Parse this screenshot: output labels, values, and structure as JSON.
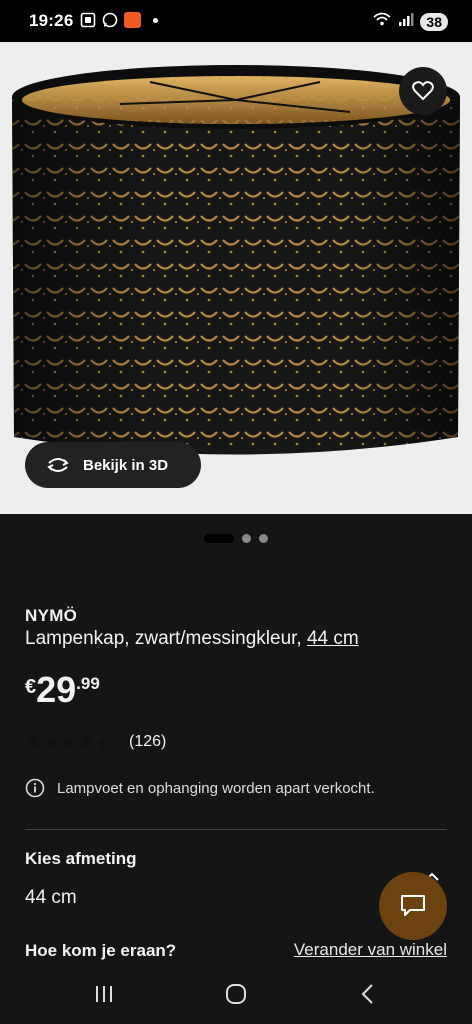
{
  "status_bar": {
    "time": "19:26",
    "battery": "38",
    "icons_left": [
      "screenshot-icon",
      "whatsapp-icon",
      "app-notification-icon"
    ],
    "icons_right": [
      "wifi-icon",
      "signal-icon"
    ]
  },
  "hero": {
    "view3d_label": "Bekijk in 3D",
    "carousel": {
      "count": 3,
      "active": 0
    }
  },
  "product": {
    "name": "NYMÖ",
    "description": "Lampenkap, zwart/messingkleur, ",
    "size_link": "44 cm",
    "price": {
      "currency": "€",
      "integer": "29",
      "decimal": ".99"
    },
    "rating": {
      "stars": 4.5,
      "max": 5,
      "count_label": "(126)"
    },
    "notice": "Lampvoet en ophanging worden apart verkocht."
  },
  "size_section": {
    "title": "Kies afmeting",
    "value": "44 cm"
  },
  "delivery_section": {
    "title": "Hoe kom je eraan?",
    "store_link": "Verander van winkel"
  },
  "colors": {
    "background": "#151515",
    "chat_button": "#6b4210",
    "brass": "#c7954a"
  }
}
